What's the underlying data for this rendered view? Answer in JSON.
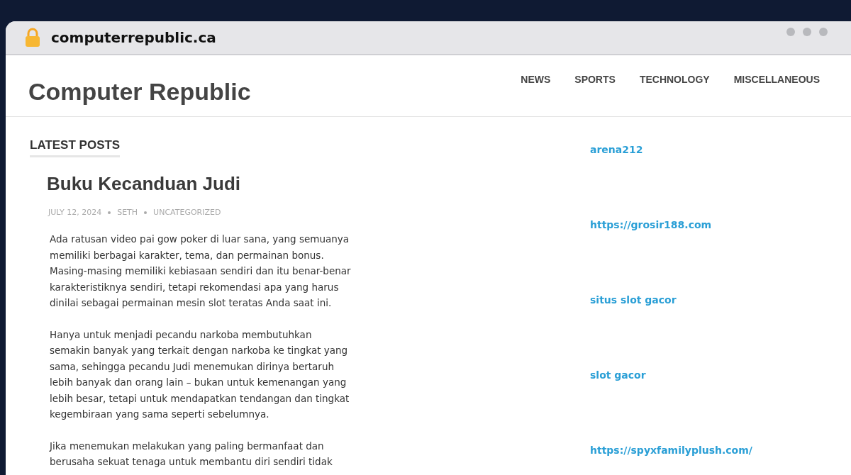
{
  "browser": {
    "url": "computerrepublic.ca"
  },
  "site": {
    "title": "Computer Republic",
    "nav": [
      {
        "label": "NEWS"
      },
      {
        "label": "SPORTS"
      },
      {
        "label": "TECHNOLOGY"
      },
      {
        "label": "MISCELLANEOUS"
      }
    ]
  },
  "main": {
    "section_title": "LATEST POSTS",
    "post": {
      "title": "Buku Kecanduan Judi",
      "date": "JULY 12, 2024",
      "author": "SETH",
      "category": "UNCATEGORIZED",
      "paragraphs": [
        "Ada ratusan video pai gow poker di luar sana, yang semuanya memiliki berbagai karakter, tema, dan permainan bonus. Masing-masing memiliki kebiasaan sendiri dan itu benar-benar karakteristiknya sendiri, tetapi rekomendasi apa yang harus dinilai sebagai permainan mesin slot teratas Anda saat ini.",
        "Hanya untuk menjadi pecandu narkoba membutuhkan semakin banyak yang terkait dengan narkoba ke tingkat yang sama, sehingga pecandu Judi menemukan dirinya bertaruh lebih banyak dan orang lain – bukan untuk kemenangan yang lebih besar, tetapi untuk mendapatkan tendangan dan tingkat kegembiraan yang sama seperti sebelumnya.",
        "Jika menemukan melakukan yang paling bermanfaat dan berusaha sekuat tenaga untuk membantu diri sendiri tidak"
      ]
    }
  },
  "sidebar": {
    "links": [
      {
        "label": "arena212"
      },
      {
        "label": "https://grosir188.com"
      },
      {
        "label": "situs slot gacor"
      },
      {
        "label": "slot gacor"
      },
      {
        "label": "https://spyxfamilyplush.com/"
      }
    ]
  }
}
